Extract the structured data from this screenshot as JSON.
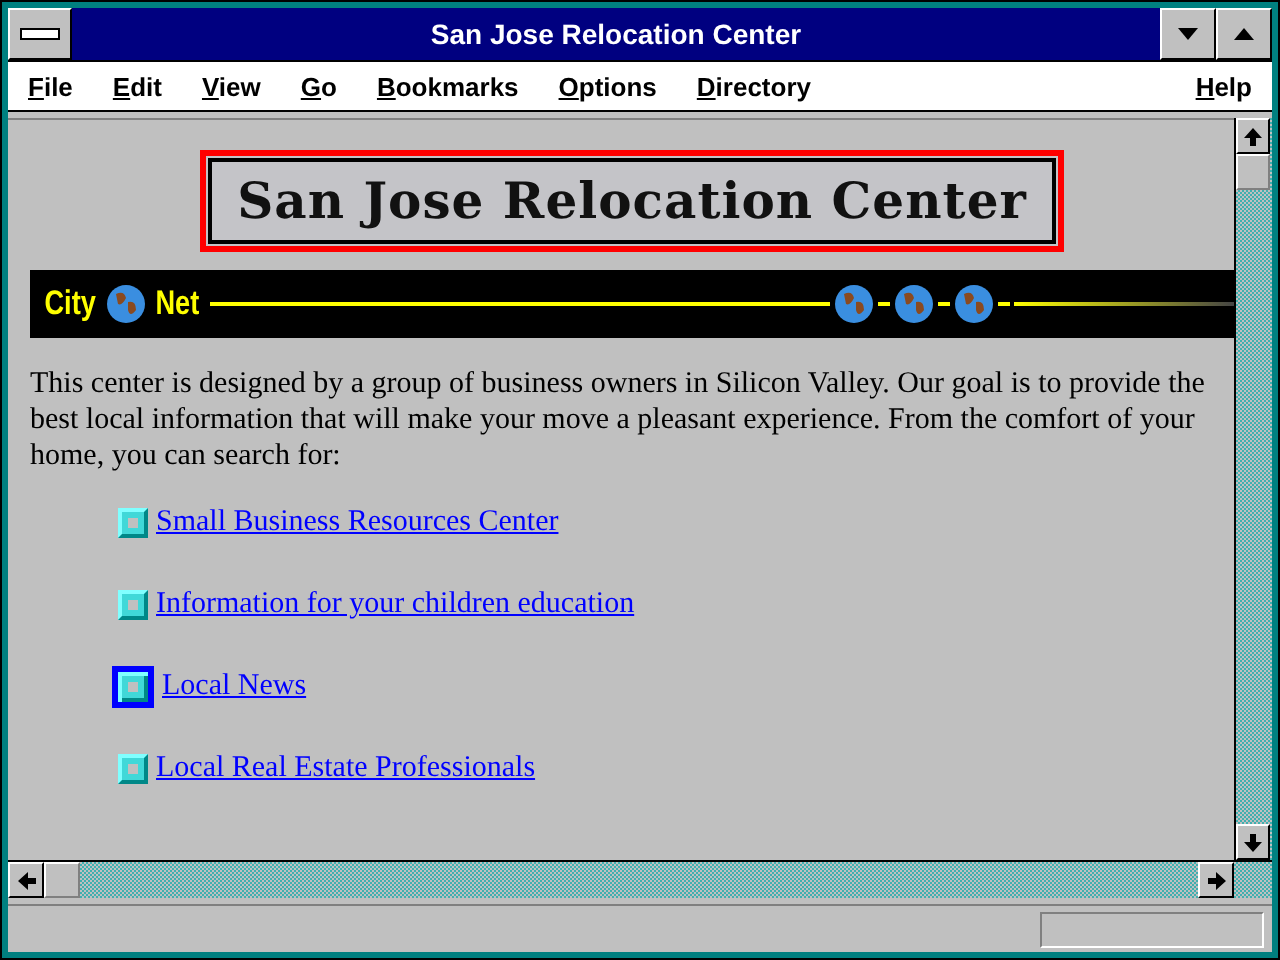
{
  "window": {
    "title": "San Jose Relocation Center"
  },
  "menu": [
    {
      "label": "File"
    },
    {
      "label": "Edit"
    },
    {
      "label": "View"
    },
    {
      "label": "Go"
    },
    {
      "label": "Bookmarks"
    },
    {
      "label": "Options"
    },
    {
      "label": "Directory"
    }
  ],
  "help_menu": {
    "label": "Help"
  },
  "banner": {
    "title": "San Jose Relocation Center"
  },
  "citynet": {
    "left": "City",
    "right": "Net"
  },
  "intro": "This center is designed by a group of business owners in Silicon Valley. Our goal is to provide the best local information that will make your move a pleasant experience. From the comfort of your home, you can search for:",
  "links": [
    {
      "label": "Small Business Resources Center",
      "selected": false
    },
    {
      "label": "Information for your children education",
      "selected": false
    },
    {
      "label": "Local News",
      "selected": true
    },
    {
      "label": "Local Real Estate Professionals",
      "selected": false
    }
  ]
}
